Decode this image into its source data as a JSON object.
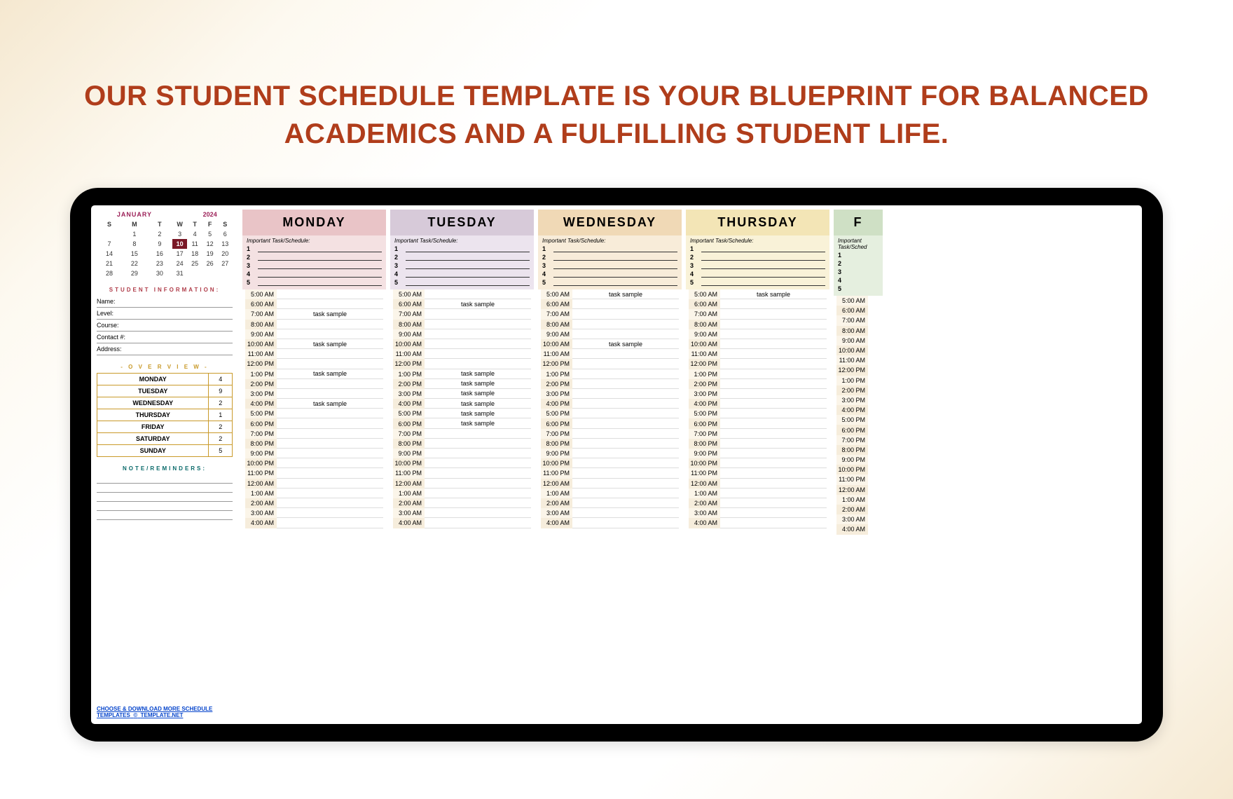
{
  "hero": "OUR STUDENT SCHEDULE TEMPLATE IS YOUR BLUEPRINT FOR BALANCED ACADEMICS AND A FULFILLING STUDENT LIFE.",
  "cal": {
    "month": "JANUARY",
    "year": "2024",
    "dow": [
      "S",
      "M",
      "T",
      "W",
      "T",
      "F",
      "S"
    ],
    "weeks": [
      [
        "",
        "1",
        "2",
        "3",
        "4",
        "5",
        "6"
      ],
      [
        "7",
        "8",
        "9",
        "10",
        "11",
        "12",
        "13"
      ],
      [
        "14",
        "15",
        "16",
        "17",
        "18",
        "19",
        "20"
      ],
      [
        "21",
        "22",
        "23",
        "24",
        "25",
        "26",
        "27"
      ],
      [
        "28",
        "29",
        "30",
        "31",
        "",
        "",
        ""
      ]
    ],
    "today": "10"
  },
  "info": {
    "title": "STUDENT INFORMATION:",
    "fields": [
      "Name:",
      "Level:",
      "Course:",
      "Contact #:",
      "Address:"
    ]
  },
  "ov": {
    "title": "- O V E R V I E W -",
    "rows": [
      {
        "d": "MONDAY",
        "n": "4"
      },
      {
        "d": "TUESDAY",
        "n": "9"
      },
      {
        "d": "WEDNESDAY",
        "n": "2"
      },
      {
        "d": "THURSDAY",
        "n": "1"
      },
      {
        "d": "FRIDAY",
        "n": "2"
      },
      {
        "d": "SATURDAY",
        "n": "2"
      },
      {
        "d": "SUNDAY",
        "n": "5"
      }
    ]
  },
  "notes": {
    "title": "NOTE/REMINDERS:"
  },
  "link": {
    "a": "CHOOSE & DOWNLOAD MORE SCHEDULE TEMPLATES",
    "sep": "©",
    "b": "TEMPLATE.NET"
  },
  "imp_label": "Important Task/Schedule:",
  "imp_nums": [
    "1",
    "2",
    "3",
    "4",
    "5"
  ],
  "times": [
    "5:00 AM",
    "6:00 AM",
    "7:00 AM",
    "8:00 AM",
    "9:00 AM",
    "10:00 AM",
    "11:00 AM",
    "12:00 PM",
    "1:00 PM",
    "2:00 PM",
    "3:00 PM",
    "4:00 PM",
    "5:00 PM",
    "6:00 PM",
    "7:00 PM",
    "8:00 PM",
    "9:00 PM",
    "10:00 PM",
    "11:00 PM",
    "12:00 AM",
    "1:00 AM",
    "2:00 AM",
    "3:00 AM",
    "4:00 AM"
  ],
  "days": [
    {
      "name": "MONDAY",
      "cls": "mon",
      "tasks": {
        "7:00 AM": "task sample",
        "10:00 AM": "task sample",
        "1:00 PM": "task sample",
        "4:00 PM": "task sample"
      }
    },
    {
      "name": "TUESDAY",
      "cls": "tue",
      "tasks": {
        "6:00 AM": "task sample",
        "1:00 PM": "task sample",
        "2:00 PM": "task sample",
        "3:00 PM": "task sample",
        "4:00 PM": "task sample",
        "5:00 PM": "task sample",
        "6:00 PM": "task sample"
      }
    },
    {
      "name": "WEDNESDAY",
      "cls": "wed",
      "tasks": {
        "5:00 AM": "task sample",
        "10:00 AM": "task sample"
      }
    },
    {
      "name": "THURSDAY",
      "cls": "thu",
      "tasks": {
        "5:00 AM": "task sample"
      }
    },
    {
      "name": "FRIDAY",
      "cls": "fri",
      "cut": true,
      "tasks": {}
    }
  ],
  "friday_initial": "F"
}
